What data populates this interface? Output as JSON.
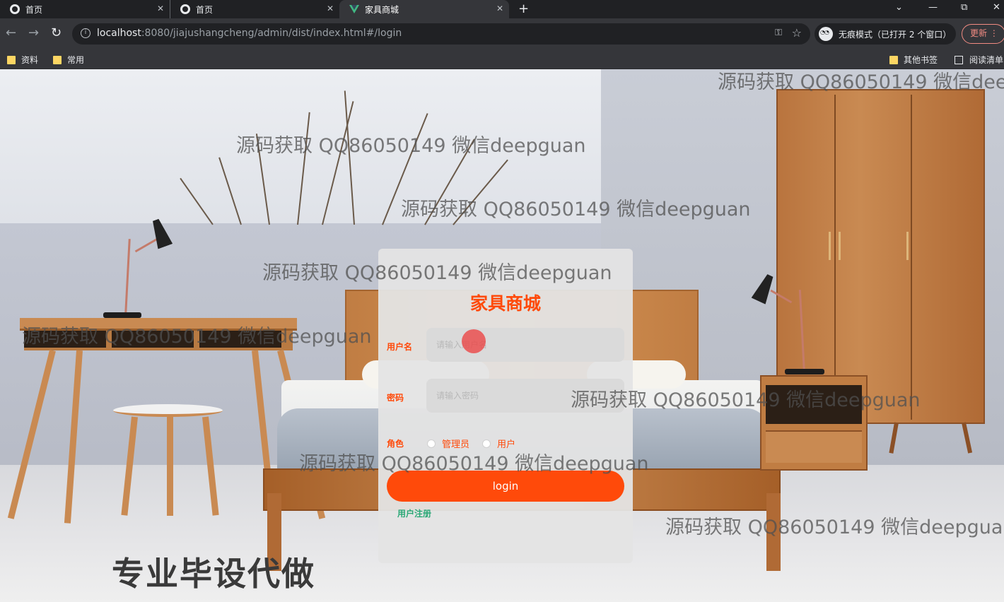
{
  "browser": {
    "tabs": [
      {
        "label": "首页",
        "active": false
      },
      {
        "label": "首页",
        "active": false
      },
      {
        "label": "家具商城",
        "active": true
      }
    ],
    "new_tab": "+",
    "window_controls": {
      "dropdown": "⌄",
      "minimize": "—",
      "restore": "⧉",
      "close": "✕"
    },
    "url_host": "localhost",
    "url_rest": ":8080/jiajushangcheng/admin/dist/index.html#/login",
    "incognito_label": "无痕模式（已打开 2 个窗口）",
    "update_label": "更新",
    "bookmarks": [
      "资料",
      "常用"
    ],
    "bookmarks_right": [
      "其他书签",
      "阅读清单"
    ]
  },
  "login": {
    "title": "家具商城",
    "username_label": "用户名",
    "username_placeholder": "请输入用户名",
    "password_label": "密码",
    "password_placeholder": "请输入密码",
    "role_label": "角色",
    "roles": [
      "管理员",
      "用户"
    ],
    "login_button": "login",
    "register_link": "用户注册"
  },
  "overlay": {
    "watermark": "源码获取 QQ86050149 微信deepguan",
    "promo": "专业毕设代做"
  },
  "colors": {
    "accent": "#ff4a0a",
    "register_link": "#2aa876",
    "card_bg": "#e4e4e4"
  }
}
